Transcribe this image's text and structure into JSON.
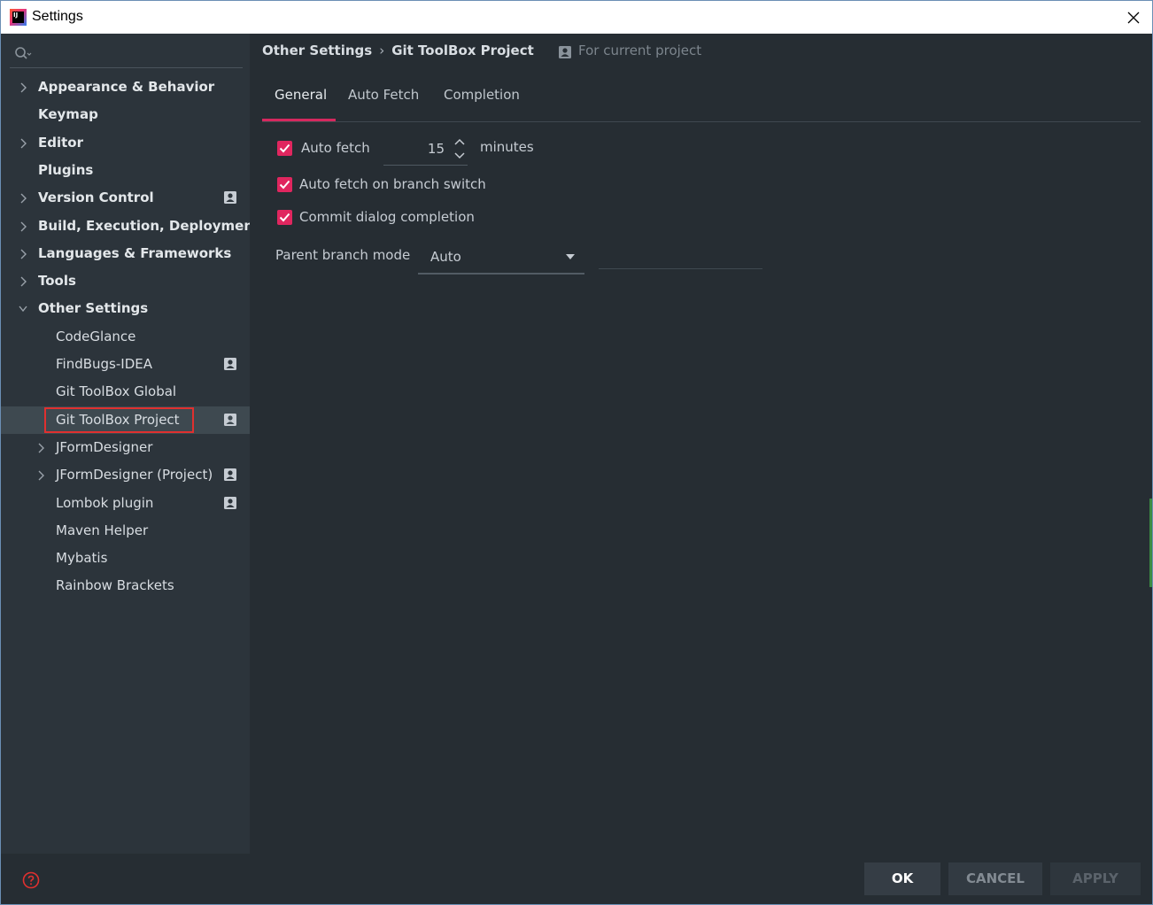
{
  "window": {
    "title": "Settings",
    "app_icon_text": "IJ"
  },
  "sidebar": {
    "search_placeholder": "",
    "items": [
      {
        "label": "Appearance & Behavior",
        "bold": true,
        "expandable": true,
        "expanded": false,
        "level": 0,
        "project_icon": false
      },
      {
        "label": "Keymap",
        "bold": true,
        "expandable": false,
        "level": 0,
        "project_icon": false
      },
      {
        "label": "Editor",
        "bold": true,
        "expandable": true,
        "expanded": false,
        "level": 0,
        "project_icon": false
      },
      {
        "label": "Plugins",
        "bold": true,
        "expandable": false,
        "level": 0,
        "project_icon": false
      },
      {
        "label": "Version Control",
        "bold": true,
        "expandable": true,
        "expanded": false,
        "level": 0,
        "project_icon": true
      },
      {
        "label": "Build, Execution, Deployment",
        "bold": true,
        "expandable": true,
        "expanded": false,
        "level": 0,
        "project_icon": false
      },
      {
        "label": "Languages & Frameworks",
        "bold": true,
        "expandable": true,
        "expanded": false,
        "level": 0,
        "project_icon": false
      },
      {
        "label": "Tools",
        "bold": true,
        "expandable": true,
        "expanded": false,
        "level": 0,
        "project_icon": false
      },
      {
        "label": "Other Settings",
        "bold": true,
        "expandable": true,
        "expanded": true,
        "level": 0,
        "project_icon": false
      },
      {
        "label": "CodeGlance",
        "bold": false,
        "expandable": false,
        "level": 1,
        "project_icon": false
      },
      {
        "label": "FindBugs-IDEA",
        "bold": false,
        "expandable": false,
        "level": 1,
        "project_icon": true
      },
      {
        "label": "Git ToolBox Global",
        "bold": false,
        "expandable": false,
        "level": 1,
        "project_icon": false
      },
      {
        "label": "Git ToolBox Project",
        "bold": false,
        "expandable": false,
        "level": 1,
        "project_icon": true,
        "selected": true
      },
      {
        "label": "JFormDesigner",
        "bold": false,
        "expandable": true,
        "expanded": false,
        "level": 1,
        "project_icon": false
      },
      {
        "label": "JFormDesigner (Project)",
        "bold": false,
        "expandable": true,
        "expanded": false,
        "level": 1,
        "project_icon": true
      },
      {
        "label": "Lombok plugin",
        "bold": false,
        "expandable": false,
        "level": 1,
        "project_icon": true
      },
      {
        "label": "Maven Helper",
        "bold": false,
        "expandable": false,
        "level": 1,
        "project_icon": false
      },
      {
        "label": "Mybatis",
        "bold": false,
        "expandable": false,
        "level": 1,
        "project_icon": false
      },
      {
        "label": "Rainbow Brackets",
        "bold": false,
        "expandable": false,
        "level": 1,
        "project_icon": false
      }
    ]
  },
  "header": {
    "breadcrumb": [
      "Other Settings",
      "Git ToolBox Project"
    ],
    "breadcrumb_separator": "›",
    "scope_label": "For current project"
  },
  "tabs": [
    {
      "label": "General",
      "active": true
    },
    {
      "label": "Auto Fetch",
      "active": false
    },
    {
      "label": "Completion",
      "active": false
    }
  ],
  "general": {
    "auto_fetch": {
      "label": "Auto fetch",
      "checked": true,
      "interval_value": "15",
      "interval_unit": "minutes"
    },
    "auto_fetch_branch_switch": {
      "label": "Auto fetch on branch switch",
      "checked": true
    },
    "commit_dialog_completion": {
      "label": "Commit dialog completion",
      "checked": true
    },
    "parent_branch_mode": {
      "label": "Parent branch mode",
      "value": "Auto",
      "extra_value": ""
    }
  },
  "footer": {
    "ok_label": "OK",
    "cancel_label": "CANCEL",
    "apply_label": "APPLY"
  },
  "colors": {
    "accent": "#e0265f",
    "background": "#262d33",
    "sidebar": "#2c343b",
    "selection": "#3e4950",
    "highlight_box": "#e0302f"
  }
}
